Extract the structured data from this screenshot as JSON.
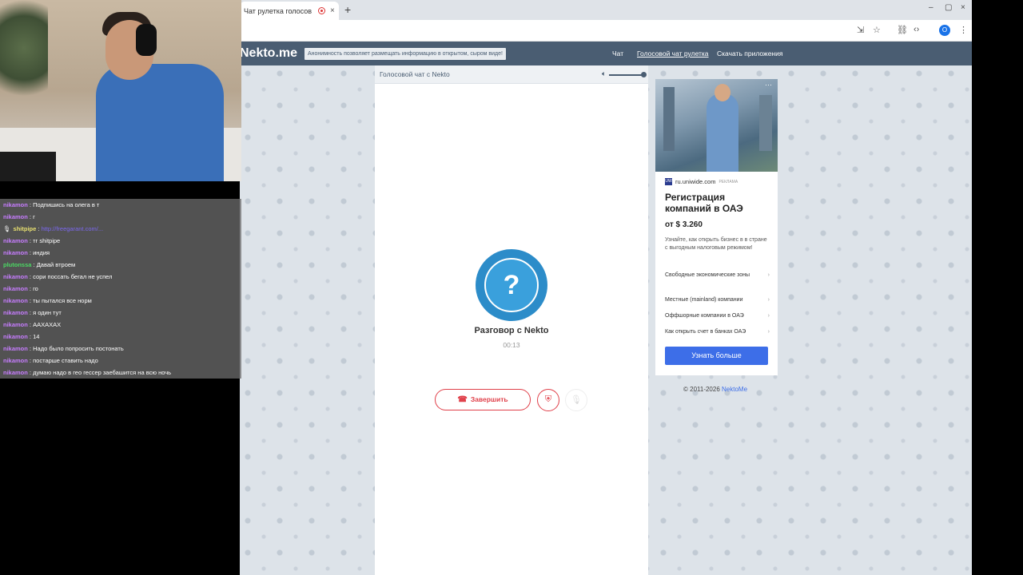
{
  "browser": {
    "tab_title": "Чат рулетка голосов",
    "tab_close": "×",
    "new_tab": "+",
    "window_controls": [
      "–",
      "▢",
      "×"
    ],
    "profile_initial": "O"
  },
  "site": {
    "logo": "Nekto.me",
    "slogan": "Анонимность позволяет размещать информацию в открытом, сыром виде!",
    "nav": [
      "Чат",
      "Голосовой чат рулетка",
      "Скачать приложения"
    ]
  },
  "chat_panel": {
    "title": "Голосовой чат с Nekto",
    "avatar_symbol": "?",
    "conversation_label": "Разговор с Nekto",
    "timer": "00:13",
    "end_button": "Завершить",
    "volume_level": 1.0
  },
  "ad": {
    "source": "ru.uniwide.com",
    "favicon_text": "UW",
    "tag": "РЕКЛАМА",
    "title": "Регистрация компаний в ОАЭ",
    "price": "от $ 3.260",
    "description": "Узнайте, как открыть бизнес в в стране с выгодным налоговым режимом!",
    "links": [
      "Свободные экономические зоны",
      "Местные (mainland) компании",
      "Оффшорные компании в ОАЭ",
      "Как открыть счет в банках ОАЭ"
    ],
    "cta": "Узнать больше",
    "more_icon": "⋯"
  },
  "footer": {
    "copyright": "© 2011-2026",
    "brand_link": "NektoMe"
  },
  "stream_chat": [
    {
      "user": "nikamon",
      "color": "#c77dff",
      "text": "Подпишись на олега в т"
    },
    {
      "user": "nikamon",
      "color": "#c77dff",
      "text": "г"
    },
    {
      "user": "shitpipe",
      "color": "#e8e070",
      "text": "http://freegarant.com/...",
      "is_link": true,
      "badge": "🎙"
    },
    {
      "user": "nikamon",
      "color": "#c77dff",
      "text": "тг shitpipe"
    },
    {
      "user": "nikamon",
      "color": "#c77dff",
      "text": "индия"
    },
    {
      "user": "plutonssa",
      "color": "#4cd964",
      "text": "Давай втроем"
    },
    {
      "user": "nikamon",
      "color": "#c77dff",
      "text": "сори поссать бегал не успел"
    },
    {
      "user": "nikamon",
      "color": "#c77dff",
      "text": "го"
    },
    {
      "user": "nikamon",
      "color": "#c77dff",
      "text": "ты пытался все норм"
    },
    {
      "user": "nikamon",
      "color": "#c77dff",
      "text": "я один тут"
    },
    {
      "user": "nikamon",
      "color": "#c77dff",
      "text": "ААХАХАХ"
    },
    {
      "user": "nikamon",
      "color": "#c77dff",
      "text": "14"
    },
    {
      "user": "nikamon",
      "color": "#c77dff",
      "text": "Надо было попросить постонать"
    },
    {
      "user": "nikamon",
      "color": "#c77dff",
      "text": "постарше ставить надо"
    },
    {
      "user": "nikamon",
      "color": "#c77dff",
      "text": "думаю надо в гео гессер заебашится на всю ночь"
    }
  ],
  "colors": {
    "header": "#4a5d72",
    "accent_red": "#e0404a",
    "avatar_blue": "#2c8cc9",
    "cta_blue": "#3d6ee8"
  }
}
